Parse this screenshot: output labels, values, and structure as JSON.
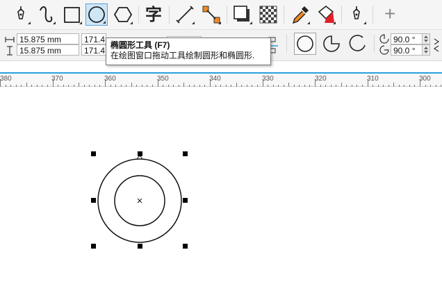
{
  "toolbar": {
    "tools": [
      {
        "icon": "pick-tool-icon"
      },
      {
        "icon": "freehand-tool-icon"
      },
      {
        "icon": "rectangle-tool-icon"
      },
      {
        "icon": "ellipse-tool-icon",
        "active": true
      },
      {
        "icon": "polygon-tool-icon"
      },
      {
        "icon": "text-tool-icon",
        "glyph": "字"
      },
      {
        "icon": "dimension-tool-icon"
      },
      {
        "icon": "connector-tool-icon"
      },
      {
        "icon": "drop-shadow-tool-icon"
      },
      {
        "icon": "transparency-tool-icon"
      },
      {
        "icon": "eyedropper-tool-icon"
      },
      {
        "icon": "interactive-fill-tool-icon"
      },
      {
        "icon": "smart-fill-tool-icon"
      },
      {
        "icon": "add-tool-icon",
        "glyph": "+"
      }
    ]
  },
  "property_bar": {
    "width_value": "15.875 mm",
    "height_value": "15.875 mm",
    "scale_x_value": "171.4",
    "scale_y_value": "171.4",
    "start_angle_value": "90.0 °",
    "end_angle_value": "90.0 °"
  },
  "tooltip": {
    "title": "椭圆形工具 (F7)",
    "description": "在绘图窗口拖动工具绘制圆形和椭圆形."
  },
  "ruler": {
    "labels": [
      "380",
      "370",
      "360",
      "350",
      "340",
      "330",
      "320",
      "310",
      "300"
    ]
  },
  "colors": {
    "accent": "#2aa0de",
    "active_tool_bg": "#cfe6f7",
    "connector_orange": "#f08a24",
    "fill_red": "#e0202a"
  }
}
